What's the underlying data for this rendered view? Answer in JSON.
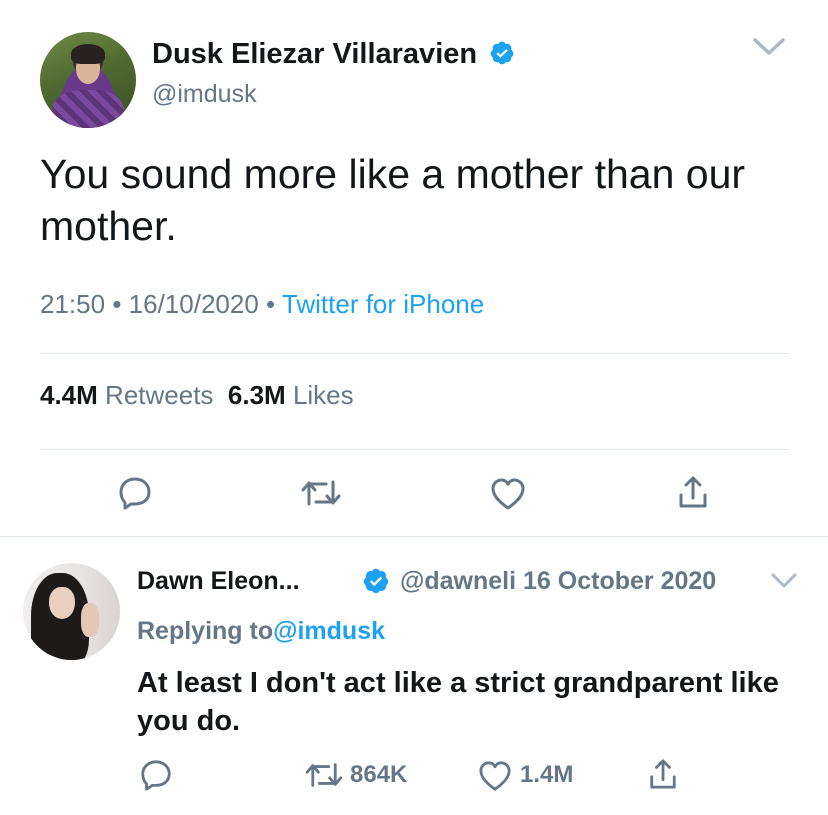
{
  "tweet": {
    "author_name": "Dusk Eliezar Villaravien",
    "author_handle": "@imdusk",
    "text": "You sound more like a mother than our mother.",
    "time": "21:50",
    "date": "16/10/2020",
    "separator": "•",
    "source": "Twitter for iPhone",
    "retweets_count": "4.4M",
    "retweets_label": "Retweets",
    "likes_count": "6.3M",
    "likes_label": "Likes"
  },
  "reply": {
    "author_name": "Dawn Eleon...",
    "author_handle": "@dawneli",
    "date": "16 October 2020",
    "replying_prefix": "Replying to",
    "replying_to": "@imdusk",
    "text": "At least I don't act like a strict grandparent like you do.",
    "retweets_count": "864K",
    "likes_count": "1.4M"
  },
  "icons": {
    "verified": "verified-badge-icon",
    "more": "chevron-down-icon",
    "reply": "reply-icon",
    "retweet": "retweet-icon",
    "like": "heart-icon",
    "share": "share-icon"
  },
  "colors": {
    "accent": "#1da1f2",
    "muted": "#657786",
    "text": "#14171a",
    "divider": "#e1e8ed"
  }
}
